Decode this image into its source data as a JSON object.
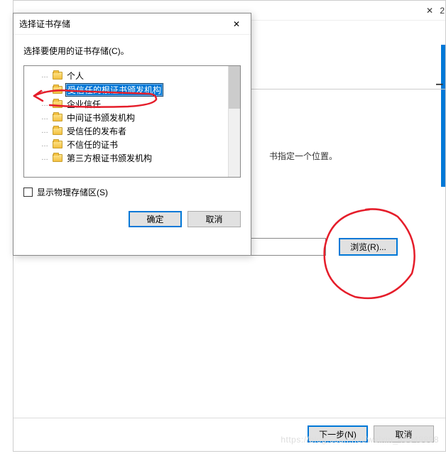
{
  "back_window": {
    "close_glyph": "✕",
    "description_suffix": "书指定一个位置。",
    "browse_label": "浏览(R)...",
    "next_label": "下一步(N)",
    "cancel_label": "取消"
  },
  "dialog": {
    "title": "选择证书存储",
    "close_glyph": "✕",
    "instruction": "选择要使用的证书存储(C)。",
    "tree_items": [
      {
        "label": "个人",
        "selected": false
      },
      {
        "label": "受信任的根证书颁发机构",
        "selected": true
      },
      {
        "label": "企业信任",
        "selected": false
      },
      {
        "label": "中间证书颁发机构",
        "selected": false
      },
      {
        "label": "受信任的发布者",
        "selected": false
      },
      {
        "label": "不信任的证书",
        "selected": false
      },
      {
        "label": "第三方根证书颁发机构",
        "selected": false
      }
    ],
    "show_physical_label": "显示物理存储区(S)",
    "ok_label": "确定",
    "cancel_label": "取消"
  },
  "crop_text_right": "l",
  "crop_num": "2",
  "watermark": "https://blog.csdn.net/weixin_40048898"
}
